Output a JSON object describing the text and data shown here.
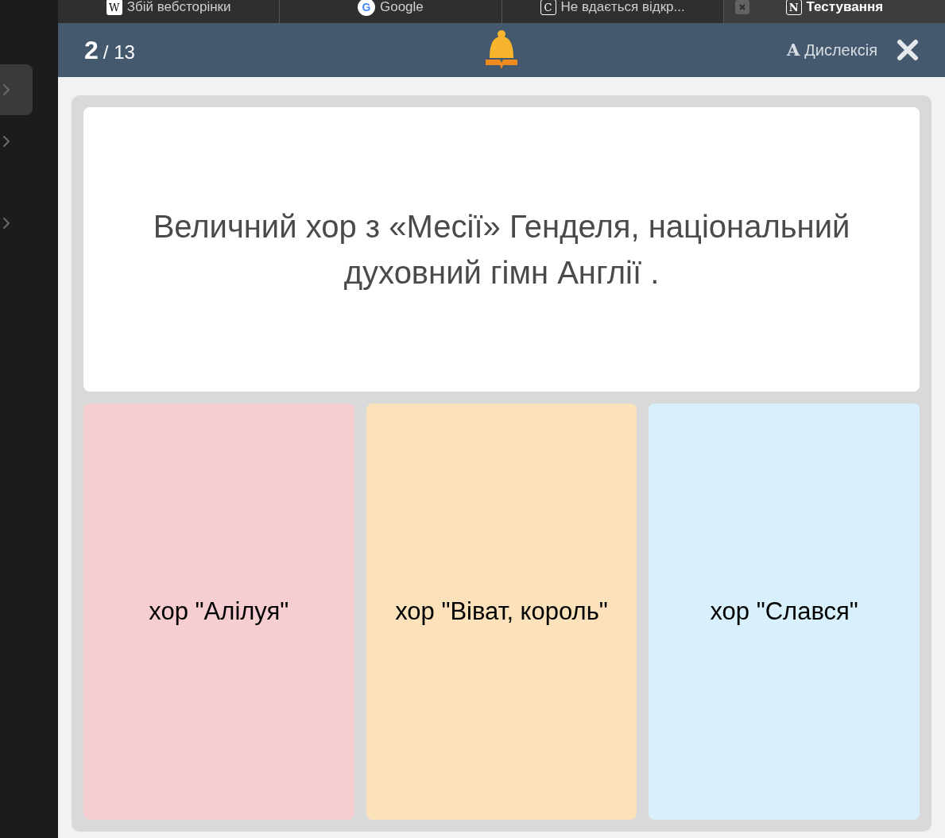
{
  "sidebar": {
    "items": [
      {
        "selected": true
      },
      {
        "selected": false
      },
      {
        "selected": false
      }
    ]
  },
  "browser_tabs": [
    {
      "label": "Збій вебсторінки",
      "icon": "W",
      "selected": false
    },
    {
      "label": "Google",
      "icon": "G",
      "selected": false
    },
    {
      "label": "Не вдається відкр...",
      "icon": "C",
      "selected": false
    },
    {
      "label": "Тестування",
      "icon": "N",
      "selected": true
    }
  ],
  "header": {
    "current": "2",
    "total": "/ 13",
    "dyslexia": {
      "icon": "A",
      "label": "Дислексія"
    }
  },
  "question": "Величний хор з «Месії» Генделя, національний духовний гімн Англії .",
  "answers": [
    {
      "label": "хор \"Алілуя\"",
      "color": "#f6cdd0"
    },
    {
      "label": "хор \"Віват, король\"",
      "color": "#fbe2bb"
    },
    {
      "label": "хор \"Слався\"",
      "color": "#d8f0fb"
    }
  ]
}
